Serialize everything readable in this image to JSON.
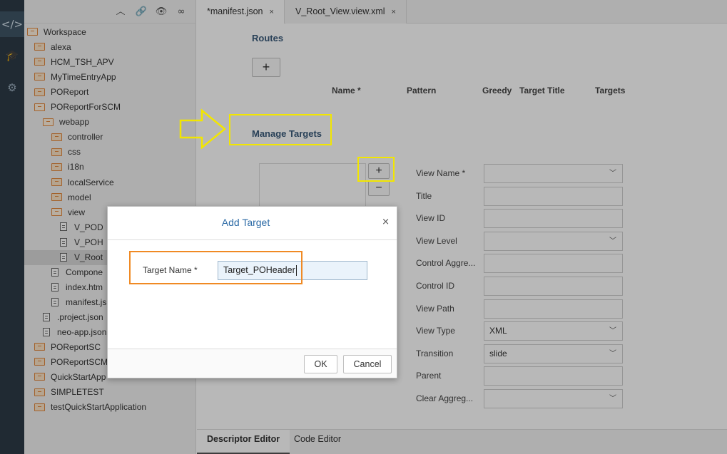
{
  "activity_bar": {
    "items": [
      {
        "name": "code-icon",
        "glyph": "</>",
        "active": true
      },
      {
        "name": "learning-icon",
        "glyph": "🎓",
        "active": false
      },
      {
        "name": "gear-icon",
        "glyph": "⚙",
        "active": false
      }
    ]
  },
  "explorer": {
    "toolbar": [
      "collapse-icon",
      "link-icon",
      "eye-icon",
      "binoculars-icon"
    ],
    "tree": [
      {
        "label": "Workspace",
        "type": "folder-open",
        "level": 0
      },
      {
        "label": "alexa",
        "type": "folder",
        "level": 1
      },
      {
        "label": "HCM_TSH_APV",
        "type": "folder",
        "level": 1
      },
      {
        "label": "MyTimeEntryApp",
        "type": "folder",
        "level": 1
      },
      {
        "label": "POReport",
        "type": "folder",
        "level": 1
      },
      {
        "label": "POReportForSCM",
        "type": "folder-open",
        "level": 1
      },
      {
        "label": "webapp",
        "type": "folder-open",
        "level": 2
      },
      {
        "label": "controller",
        "type": "folder",
        "level": 3
      },
      {
        "label": "css",
        "type": "folder",
        "level": 3
      },
      {
        "label": "i18n",
        "type": "folder",
        "level": 3
      },
      {
        "label": "localService",
        "type": "folder",
        "level": 3
      },
      {
        "label": "model",
        "type": "folder",
        "level": 3
      },
      {
        "label": "view",
        "type": "folder-open",
        "level": 3
      },
      {
        "label": "V_POD",
        "type": "file",
        "level": 4
      },
      {
        "label": "V_POH",
        "type": "file",
        "level": 4
      },
      {
        "label": "V_Root",
        "type": "file",
        "level": 4,
        "selected": true
      },
      {
        "label": "Compone",
        "type": "file",
        "level": 3
      },
      {
        "label": "index.htm",
        "type": "file",
        "level": 3
      },
      {
        "label": "manifest.js",
        "type": "file",
        "level": 3
      },
      {
        "label": ".project.json",
        "type": "file",
        "level": 2
      },
      {
        "label": "neo-app.json",
        "type": "file",
        "level": 2
      },
      {
        "label": "POReportSC",
        "type": "folder",
        "level": 1
      },
      {
        "label": "POReportSCM",
        "type": "folder",
        "level": 1
      },
      {
        "label": "QuickStartApp",
        "type": "folder",
        "level": 1
      },
      {
        "label": "SIMPLETEST",
        "type": "folder",
        "level": 1
      },
      {
        "label": "testQuickStartApplication",
        "type": "folder",
        "level": 1
      }
    ]
  },
  "tabs": [
    {
      "label": "*manifest.json",
      "close": "×",
      "active": true
    },
    {
      "label": "V_Root_View.view.xml",
      "close": "×",
      "active": false
    }
  ],
  "editor": {
    "routes_title": "Routes",
    "add_route": "+",
    "columns": [
      "Name *",
      "Pattern",
      "Greedy",
      "Target Title",
      "Targets"
    ],
    "manage_targets_title": "Manage Targets",
    "add_target": "+",
    "remove_target": "−",
    "fields": [
      {
        "label": "View Name *",
        "value": "",
        "dropdown": true
      },
      {
        "label": "Title",
        "value": "",
        "dropdown": false
      },
      {
        "label": "View ID",
        "value": "",
        "dropdown": false
      },
      {
        "label": "View Level",
        "value": "",
        "dropdown": true
      },
      {
        "label": "Control Aggre...",
        "value": "",
        "dropdown": false
      },
      {
        "label": "Control ID",
        "value": "",
        "dropdown": false
      },
      {
        "label": "View Path",
        "value": "",
        "dropdown": false
      },
      {
        "label": "View Type",
        "value": "XML",
        "dropdown": true
      },
      {
        "label": "Transition",
        "value": "slide",
        "dropdown": true
      },
      {
        "label": "Parent",
        "value": "",
        "dropdown": false
      },
      {
        "label": "Clear Aggreg...",
        "value": "",
        "dropdown": true
      }
    ],
    "dropdown_glyph": "﹀"
  },
  "bottom_tabs": [
    {
      "label": "Descriptor Editor",
      "active": true
    },
    {
      "label": "Code Editor",
      "active": false
    }
  ],
  "dialog": {
    "title": "Add Target",
    "close": "×",
    "target_name_label": "Target Name  *",
    "target_name_value": "Target_POHeader",
    "ok": "OK",
    "cancel": "Cancel"
  },
  "annotation_colors": {
    "highlight_yellow": "#f2e600",
    "highlight_orange": "#f08a24"
  }
}
